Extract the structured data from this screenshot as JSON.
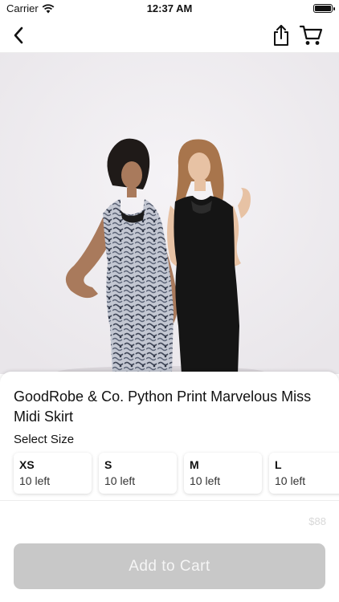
{
  "status_bar": {
    "carrier": "Carrier",
    "time": "12:37 AM",
    "battery_level": 1.0
  },
  "nav": {
    "back_icon": "chevron-left-icon",
    "share_icon": "share-icon",
    "cart_icon": "cart-icon"
  },
  "product": {
    "image_icon": "product-photo",
    "title": "GoodRobe & Co. Python Print Marvelous Miss Midi Skirt",
    "select_size_label": "Select Size",
    "sizes": [
      {
        "name": "XS",
        "stock": "10 left"
      },
      {
        "name": "S",
        "stock": "10 left"
      },
      {
        "name": "M",
        "stock": "10 left"
      },
      {
        "name": "L",
        "stock": "10 left"
      }
    ],
    "price": "$88"
  },
  "actions": {
    "add_to_cart_label": "Add to Cart"
  },
  "colors": {
    "button_disabled": "#c8c8c8",
    "price_text": "#d8d8d8",
    "photo_background": "#f0eef1"
  }
}
